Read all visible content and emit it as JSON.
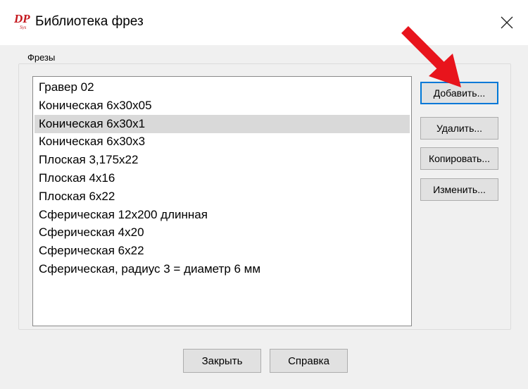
{
  "window": {
    "title": "Библиотека фрез",
    "icon_name": "dp-app-icon",
    "close_icon": "close-icon"
  },
  "group": {
    "label": "Фрезы"
  },
  "list": {
    "items": [
      "Гравер 02",
      "Коническая 6х30х05",
      "Коническая 6х30х1",
      "Коническая 6х30х3",
      "Плоская 3,175х22",
      "Плоская 4х16",
      "Плоская 6х22",
      "Сферическая 12х200 длинная",
      "Сферическая 4х20",
      "Сферическая 6х22",
      "Сферическая, радиус 3 = диаметр 6 мм"
    ],
    "selected": "Коническая 6х30х1"
  },
  "buttons": {
    "add": "Добавить...",
    "delete": "Удалить...",
    "copy": "Копировать...",
    "edit": "Изменить...",
    "close": "Закрыть",
    "help": "Справка"
  },
  "annotation": {
    "arrow_color": "#e8141c",
    "icon_name": "red-arrow-icon"
  }
}
